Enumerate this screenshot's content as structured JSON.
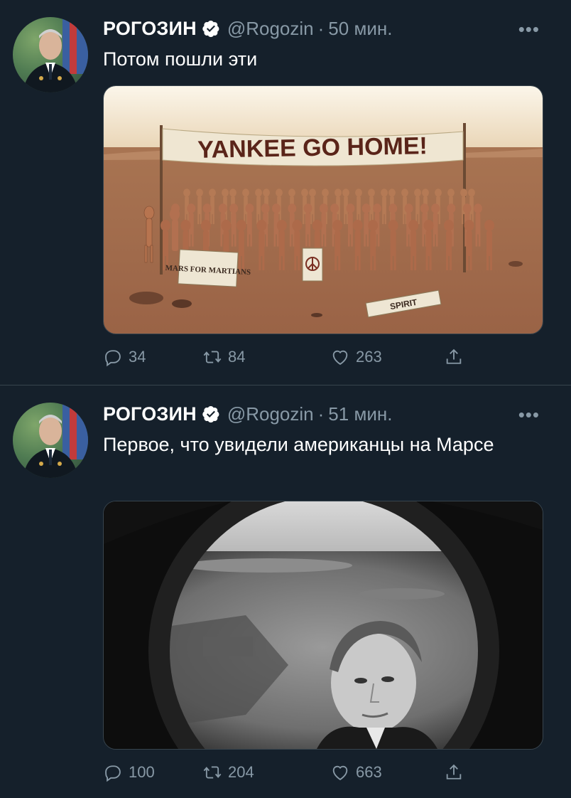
{
  "tweets": [
    {
      "name": "РОГОЗИН",
      "handle": "@Rogozin",
      "separator": "·",
      "time": "50 мин.",
      "more": "•••",
      "text": "Потом пошли эти",
      "media_banner": "YANKEE GO HOME!",
      "media_sign_1": "MARS FOR MARTIANS",
      "media_sign_2": "SPIRIT",
      "replies": "34",
      "retweets": "84",
      "likes": "263"
    },
    {
      "name": "РОГОЗИН",
      "handle": "@Rogozin",
      "separator": "·",
      "time": "51 мин.",
      "more": "•••",
      "text": "Первое, что увидели американцы на Марсе",
      "replies": "100",
      "retweets": "204",
      "likes": "663"
    }
  ],
  "colors": {
    "background": "#15202b",
    "secondary_text": "#8899a6",
    "verified_badge": "#ffffff",
    "divider": "#38444d"
  },
  "icons": [
    "verified-icon",
    "more-icon",
    "reply-icon",
    "retweet-icon",
    "like-icon",
    "share-icon"
  ]
}
